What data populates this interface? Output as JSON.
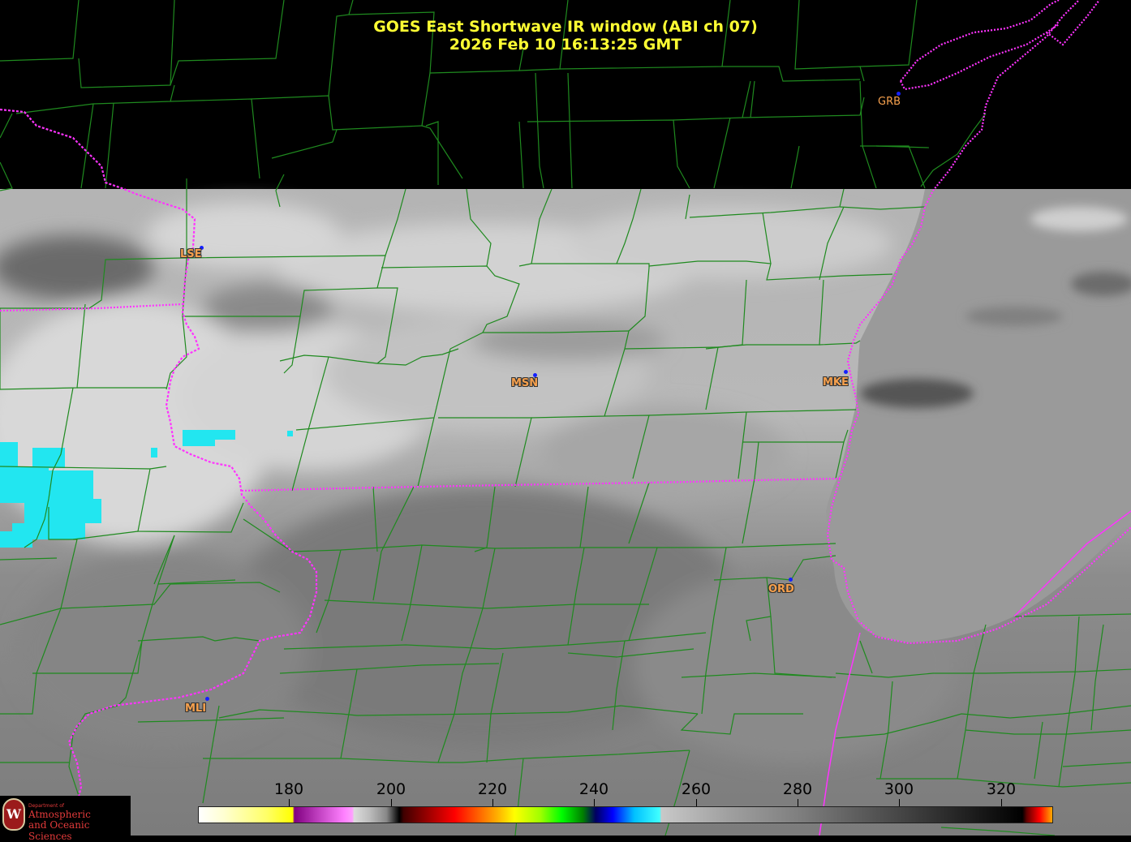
{
  "title": {
    "line1": "GOES East Shortwave IR window (ABI ch 07)",
    "line2": "2026 Feb 10  16:13:25 GMT"
  },
  "stations": [
    {
      "id": "LSE",
      "label": "LSE"
    },
    {
      "id": "MSN",
      "label": "MSN"
    },
    {
      "id": "MKE",
      "label": "MKE"
    },
    {
      "id": "ORD",
      "label": "ORD"
    },
    {
      "id": "MLI",
      "label": "MLI"
    },
    {
      "id": "GRB",
      "label": "GRB"
    }
  ],
  "colorbar": {
    "ticks": [
      "180",
      "200",
      "220",
      "240",
      "260",
      "280",
      "300",
      "320"
    ],
    "range": [
      162,
      330
    ]
  },
  "logo": {
    "seal": "W",
    "dept": "Department of",
    "name_line1": "Atmospheric",
    "name_line2": "and Oceanic Sciences"
  },
  "colors": {
    "county_lines": "#1f8a1f",
    "state_lines": "#ff33ff",
    "title": "#ffff33",
    "station_label": "#f6a04d",
    "station_dot": "#1420ff"
  }
}
